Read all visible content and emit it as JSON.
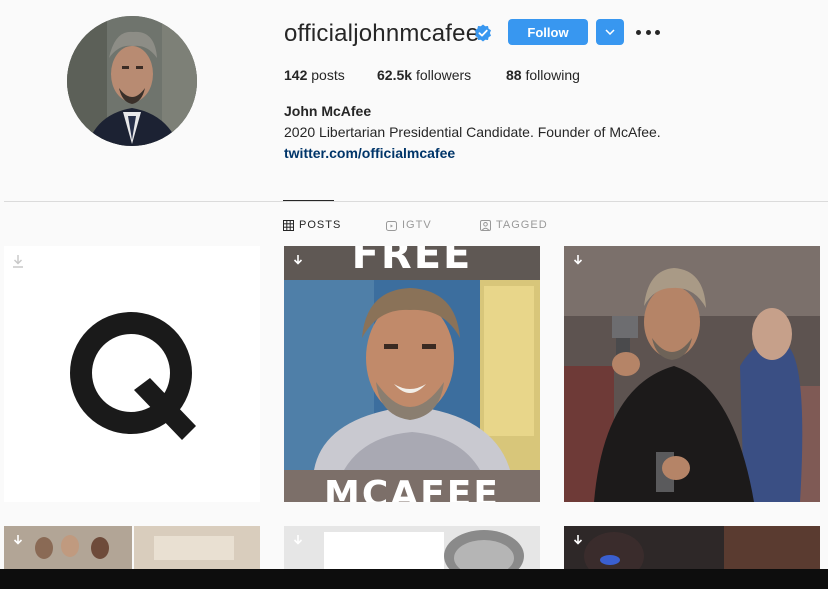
{
  "profile": {
    "username": "officialjohnmcafee",
    "follow_label": "Follow",
    "posts_count": "142",
    "posts_label": "posts",
    "followers_count": "62.5k",
    "followers_label": "followers",
    "following_count": "88",
    "following_label": "following",
    "full_name": "John McAfee",
    "bio": "2020 Libertarian Presidential Candidate. Founder of McAfee.",
    "link": "twitter.com/officialmcafee"
  },
  "tabs": [
    {
      "label": "POSTS",
      "icon": "grid-icon",
      "active": true
    },
    {
      "label": "IGTV",
      "icon": "igtv-icon",
      "active": false
    },
    {
      "label": "TAGGED",
      "icon": "tagged-icon",
      "active": false
    }
  ],
  "posts": [
    {
      "overlay_text": "Q",
      "kind": "letter"
    },
    {
      "overlay_top": "FREE",
      "overlay_bottom": "MCAFEE",
      "kind": "photo"
    },
    {
      "kind": "photo"
    }
  ],
  "colors": {
    "accent": "#3897f0",
    "link": "#003569",
    "divider": "#dbdbdb"
  }
}
